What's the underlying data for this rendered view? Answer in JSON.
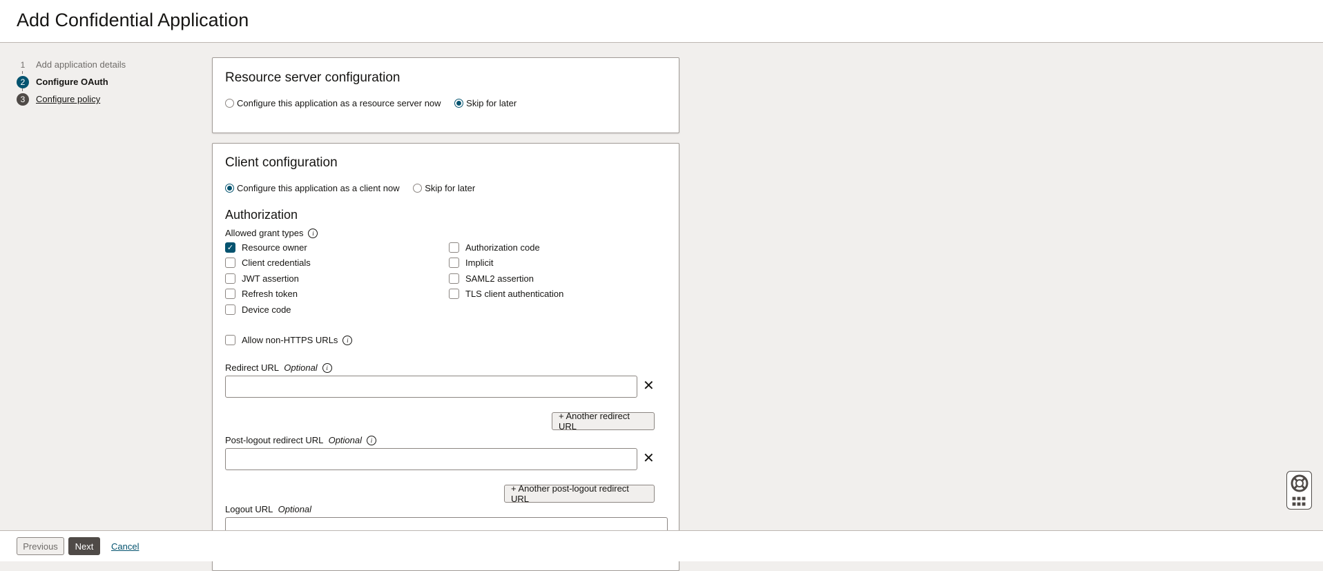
{
  "header": {
    "title": "Add Confidential Application"
  },
  "steps": [
    {
      "num": "1",
      "label": "Add application details"
    },
    {
      "num": "2",
      "label": "Configure OAuth"
    },
    {
      "num": "3",
      "label": "Configure policy"
    }
  ],
  "resource": {
    "title": "Resource server configuration",
    "opt1": "Configure this application as a resource server now",
    "opt2": "Skip for later"
  },
  "client": {
    "title": "Client configuration",
    "opt1": "Configure this application as a client now",
    "opt2": "Skip for later",
    "auth_title": "Authorization",
    "grant_label": "Allowed grant types",
    "grants": [
      {
        "label": "Resource owner",
        "checked": true
      },
      {
        "label": "Client credentials"
      },
      {
        "label": "JWT assertion"
      },
      {
        "label": "Refresh token"
      },
      {
        "label": "Device code"
      },
      {
        "label": "Authorization code"
      },
      {
        "label": "Implicit"
      },
      {
        "label": "SAML2 assertion"
      },
      {
        "label": "TLS client authentication"
      }
    ],
    "non_https": "Allow non-HTTPS URLs",
    "redirect_label": "Redirect URL",
    "optional": "Optional",
    "another_redirect": "+ Another redirect URL",
    "postlogout_label": "Post-logout redirect URL",
    "another_postlogout": "+ Another post-logout redirect URL",
    "logout_label": "Logout URL"
  },
  "footer": {
    "previous": "Previous",
    "next": "Next",
    "cancel": "Cancel"
  }
}
